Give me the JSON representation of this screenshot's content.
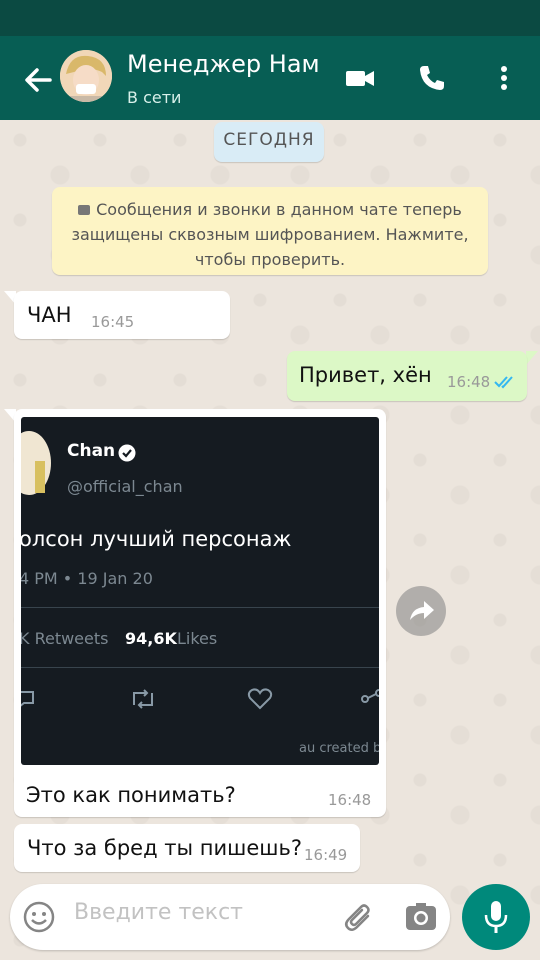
{
  "header": {
    "contact_name": "Менеджер Нам",
    "status": "В сети"
  },
  "chat": {
    "date_chip": "СЕГОДНЯ",
    "encryption_line1": "Сообщения и звонки в данном чате теперь",
    "encryption_line2": "защищены сквозным шифрованием. Нажмите,",
    "encryption_line3": "чтобы проверить.",
    "messages": [
      {
        "direction": "in",
        "text": "ЧАН",
        "time": "16:45"
      },
      {
        "direction": "out",
        "text": "Привет, хён",
        "time": "16:48",
        "read": true
      },
      {
        "direction": "in",
        "type": "image",
        "caption": "Это как понимать?",
        "time": "16:48"
      },
      {
        "direction": "in",
        "text": "Что за бред ты пишешь?",
        "time": "16:49"
      }
    ]
  },
  "tweet_image": {
    "name": "Chan",
    "handle": "@official_chan",
    "text": "олсон лучший персонаж",
    "datetime": "4 PM • 19 Jan 20",
    "retweets_label": "K Retweets",
    "likes_count": "94,6K",
    "likes_label": "Likes",
    "watermark": "au created b"
  },
  "composer": {
    "placeholder": "Введите текст"
  },
  "colors": {
    "header_bg": "#075E54",
    "status_bar": "#0B4A42",
    "outgoing_bubble": "#DCF8C6",
    "mic_button": "#00897B",
    "read_ticks": "#34B7F1"
  },
  "icons": [
    "back-arrow-icon",
    "video-call-icon",
    "voice-call-icon",
    "more-options-icon",
    "lock-icon",
    "forward-icon",
    "emoji-icon",
    "attach-icon",
    "camera-icon",
    "mic-icon"
  ]
}
